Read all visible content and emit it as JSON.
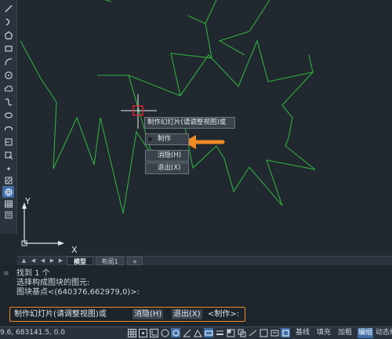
{
  "toolbar": {
    "icons": [
      "line-icon",
      "arc-icon",
      "polygon-icon",
      "rectangle-icon",
      "curve-icon",
      "circle-icon",
      "cloud-icon",
      "spline-icon",
      "ellipse-icon",
      "ellipse-arc-icon",
      "insert-block-icon",
      "make-block-icon",
      "point-icon",
      "hatch-icon",
      "region-icon",
      "table-icon",
      "mtext-icon"
    ]
  },
  "canvas": {
    "axis_x_label": "X",
    "axis_y_label": "Y",
    "stroke_color": "#2fae3c",
    "background": "#212830"
  },
  "popup": {
    "tooltip": "制作幻灯片(请调整视图)或",
    "items": [
      {
        "label": "制作",
        "selected": true
      },
      {
        "label": "消隐(H)",
        "selected": false
      },
      {
        "label": "退出(X)",
        "selected": false
      }
    ],
    "arrow_color": "#f08a24"
  },
  "tabs": {
    "items": [
      {
        "label": "模型",
        "active": true
      },
      {
        "label": "布局1",
        "active": false
      },
      {
        "label": "+",
        "active": false
      }
    ]
  },
  "command": {
    "history": [
      "找到 1 个",
      "选择构成图块的图元:",
      "图块基点<(640376,662979,0)>:"
    ],
    "prompt": {
      "text": "制作幻灯片(请调整视图)或",
      "options": [
        "消隐(H)",
        "退出(X)"
      ],
      "default": "<制作>:"
    }
  },
  "status": {
    "coords": "9.6, 683141.5, 0.0",
    "labels": [
      "基线",
      "填充",
      "加粗",
      "编组",
      "动态组"
    ],
    "active_label": "编组"
  }
}
